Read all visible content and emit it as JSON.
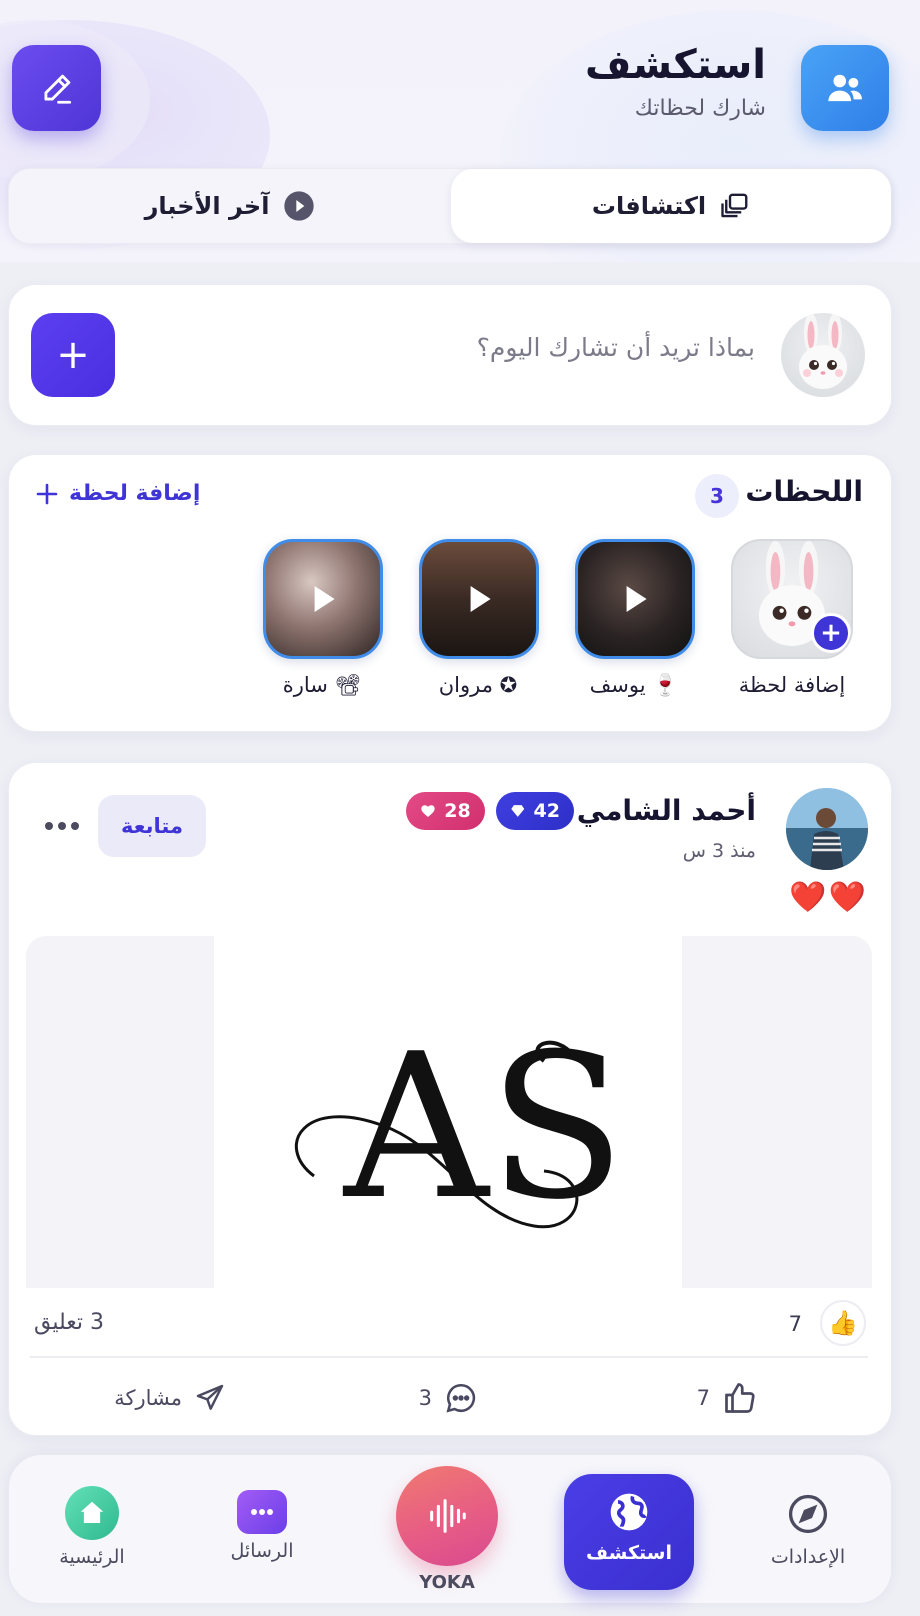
{
  "header": {
    "title": "استكشف",
    "subtitle": "شارك لحظاتك"
  },
  "tabs": [
    {
      "label": "اكتشافات",
      "icon": "gallery-icon",
      "active": true
    },
    {
      "label": "آخر الأخبار",
      "icon": "play-circle-icon",
      "active": false
    }
  ],
  "composer": {
    "placeholder": "بماذا تريد أن تشارك اليوم؟",
    "add_label": "+"
  },
  "moments": {
    "title": "اللحظات",
    "count": "3",
    "add_label": "إضافة لحظة",
    "add_moment_label": "إضافة لحظة",
    "items": [
      {
        "name": "يوسف",
        "emoji": "🍷"
      },
      {
        "name": "مروان",
        "emoji": "✪"
      },
      {
        "name": "سارة",
        "emoji": "📽"
      }
    ]
  },
  "post": {
    "author": "أحمد الشامي",
    "time": "منذ 3 س",
    "gems": "42",
    "likes_badge": "28",
    "follow_label": "متابعة",
    "hearts": "❤️❤️",
    "image_text": "AS",
    "likes_count": "7",
    "like_emoji": "👍",
    "comments_summary": "3 تعليق",
    "actions": {
      "like_count": "7",
      "comment_count": "3",
      "share_label": "مشاركة"
    }
  },
  "nav": {
    "settings": "الإعدادات",
    "explore": "استكشف",
    "yoka": "YOKA",
    "messages": "الرسائل",
    "home": "الرئيسية"
  },
  "colors": {
    "accent": "#4a3ee6",
    "blue": "#2f7fe8",
    "pink": "#d12f6e"
  }
}
